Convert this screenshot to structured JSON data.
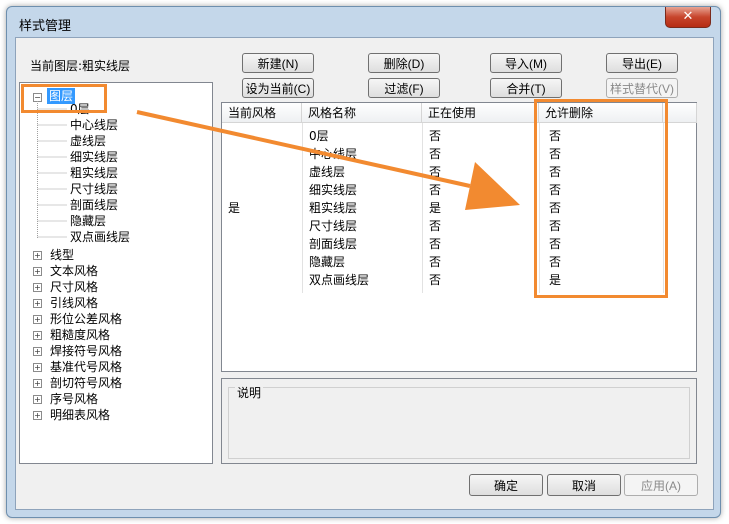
{
  "window": {
    "title": "样式管理",
    "close_glyph": "✕"
  },
  "current_layer": "当前图层:粗实线层",
  "buttons": {
    "new": "新建(N)",
    "delete": "删除(D)",
    "import": "导入(M)",
    "export": "导出(E)",
    "set_current": "设为当前(C)",
    "filter": "过滤(F)",
    "merge": "合并(T)",
    "replace": "样式替代(V)",
    "ok": "确定",
    "cancel": "取消",
    "apply": "应用(A)"
  },
  "tree": {
    "root": "图层",
    "layers": [
      "0层",
      "中心线层",
      "虚线层",
      "细实线层",
      "粗实线层",
      "尺寸线层",
      "剖面线层",
      "隐藏层",
      "双点画线层"
    ],
    "categories": [
      "线型",
      "文本风格",
      "尺寸风格",
      "引线风格",
      "形位公差风格",
      "粗糙度风格",
      "焊接符号风格",
      "基准代号风格",
      "剖切符号风格",
      "序号风格",
      "明细表风格"
    ]
  },
  "table": {
    "headers": [
      "当前风格",
      "风格名称",
      "正在使用",
      "允许删除"
    ],
    "rows": [
      [
        "",
        "0层",
        "否",
        "否"
      ],
      [
        "",
        "中心线层",
        "否",
        "否"
      ],
      [
        "",
        "虚线层",
        "否",
        "否"
      ],
      [
        "",
        "细实线层",
        "否",
        "否"
      ],
      [
        "是",
        "粗实线层",
        "是",
        "否"
      ],
      [
        "",
        "尺寸线层",
        "否",
        "否"
      ],
      [
        "",
        "剖面线层",
        "否",
        "否"
      ],
      [
        "",
        "隐藏层",
        "否",
        "否"
      ],
      [
        "",
        "双点画线层",
        "否",
        "是"
      ]
    ]
  },
  "description_label": "说明",
  "colors": {
    "annotation": "#f28a30",
    "selection": "#3399ff",
    "title_bar": "#c4d7ea",
    "close_button": "#c7452c"
  }
}
